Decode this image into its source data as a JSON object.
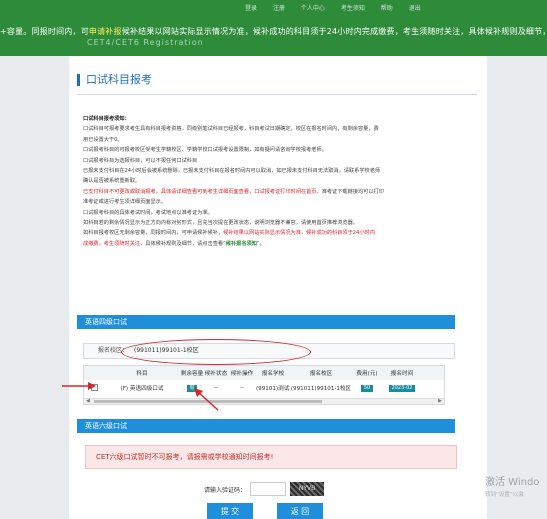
{
  "banner": {
    "marquee_pre": "+容量。同报时间内，可",
    "marquee_hl": "申请补报",
    "marquee_post": "候补结果以网站实际显示情况为准，候补成功的科目须于24小时内完成缴费，考生须随时关注，具体候补规则及细节，请点",
    "logo": "CET4/CET6 Registration",
    "topnav": [
      "登录",
      "注册",
      "个人中心",
      "考生须知",
      "帮助",
      "退出"
    ]
  },
  "page": {
    "title": "口试科目报考"
  },
  "notice": {
    "heading": "口试科目报考须知：",
    "lines": [
      "口试科目可报考要求考生具有科目报考资格，同级别笔试科目已经报考，科目考试日期确定，校区在报名时间内，有剩余容量，费",
      "用已设置大于0。",
      "口试报考科目的可报考校区受考生学籍校区、学籍学校口试报考设置限制，如有疑问请咨询学校报考老师。",
      "口试报考科目为选报科目，可以不报任何口试科目",
      "已报未支付科目在24小时后会被系统删除，已报未支付科目在报名时间内可以取消，如已报未支付科目无法取消，请联系学校老师",
      "确认是否被系统重新取。"
    ],
    "red_line1": "已支付科目不可更改或取消报考，具体请详细查看可到考生详细页面查看，口试报考证打印时间在首页，",
    "red_line1_tail": "准考证下载链接均可以打印",
    "lines2": [
      "准考证或进行考生须详细页面显示。",
      "口试报考科目的具体考试时间，考试地点以准考证为准。",
      "如科目若的剩余情况显示为正方向内有对劣形式，且充当次提在更改状态，说明浏览器不兼容，请使用首页推荐浏览器。",
      "如科目报考校区无剩余容量，同报时间内，可申请候补候补，"
    ],
    "red_line2": "候补结果以网站实际显示情况为准，候补成功的科目须于24小时内",
    "red_line3": "成缴费，考生须随时关注，",
    "line3_mid": "具体候补规则及细节，请点击查看“",
    "green_link": "候补报名须知",
    "line3_end": "”。"
  },
  "section1": {
    "title": "英语四级口试",
    "campus_label": "报名校区：",
    "campus_value": "(991011)99101-1校区",
    "table": {
      "headers": [
        "",
        "科目",
        "剩余容量",
        "候补状态",
        "候补操作",
        "报名学校",
        "报名校区",
        "费用(元)",
        "报名时间"
      ],
      "row": {
        "subject": "(F) 英语四级口试",
        "quota": "有",
        "waitlist_status": "--",
        "waitlist_action": "--",
        "school": "(99101)测试学校",
        "campus": "(991011)99101-1校区",
        "fee": "50",
        "time": "2023-02"
      }
    }
  },
  "section2": {
    "title": "英语六级口试",
    "warning": "CET六级口试暂时不可报考，请报需或学校通知时间报考!"
  },
  "captcha": {
    "label": "请输入验证码：",
    "image_text": "NYVB",
    "value": ""
  },
  "buttons": {
    "submit": "提 交",
    "back": "返 回"
  },
  "watermark": {
    "line1": "激活 Windo",
    "line2": "转到“设置”以激"
  },
  "colors": {
    "banner_green": "#2e8b3a",
    "accent_blue": "#1f8fdb",
    "alert_red": "#d9262b"
  }
}
